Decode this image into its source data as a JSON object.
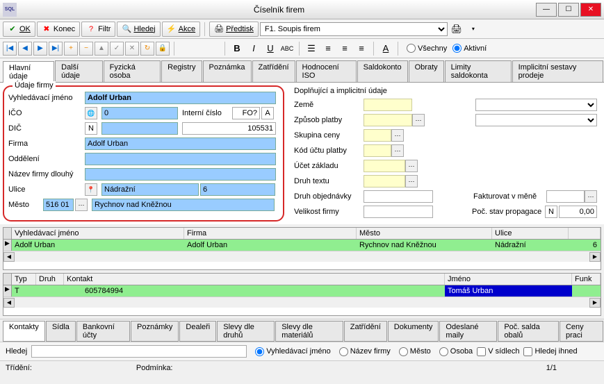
{
  "window": {
    "title": "Číselník firem",
    "icon_text": "SQL"
  },
  "toolbar1": {
    "ok": "OK",
    "konec": "Konec",
    "filtr": "Filtr",
    "hledej": "Hledej",
    "akce": "Akce",
    "predtisk": "Předtisk",
    "select_value": "F1. Soupis firem"
  },
  "toolbar2": {
    "radio_all": "Všechny",
    "radio_active": "Aktivní"
  },
  "tabs_main": [
    "Hlavní údaje",
    "Další údaje",
    "Fyzická osoba",
    "Registry",
    "Poznámka",
    "Zatřídění",
    "Hodnocení ISO",
    "Saldokonto",
    "Obraty",
    "Limity saldokonta",
    "Implicitní sestavy prodeje"
  ],
  "left_form": {
    "title": "Údaje firmy",
    "vyhledavaci_jmeno_label": "Vyhledávací jméno",
    "vyhledavaci_jmeno": "Adolf Urban",
    "ico_label": "IČO",
    "ico": "0",
    "interni_cislo_label": "Interní číslo",
    "interni_cislo": "FO?",
    "interni_suffix": "A",
    "dic_label": "DIČ",
    "dic_n": "N",
    "dic": "",
    "dic_num": "105531",
    "firma_label": "Firma",
    "firma": "Adolf Urban",
    "oddeleni_label": "Oddělení",
    "oddeleni": "",
    "nazev_dlouhy_label": "Název firmy dlouhý",
    "nazev_dlouhy": "",
    "ulice_label": "Ulice",
    "ulice": "Nádražní",
    "ulice_cislo": "6",
    "mesto_label": "Město",
    "psc": "516 01",
    "mesto": "Rychnov nad Kněžnou"
  },
  "right_form": {
    "title": "Doplňující a implicitní údaje",
    "zeme_label": "Země",
    "zpusob_platby_label": "Způsob platby",
    "skupina_ceny_label": "Skupina ceny",
    "kod_uctu_label": "Kód účtu platby",
    "ucet_zakladu_label": "Účet základu",
    "druh_textu_label": "Druh textu",
    "druh_obj_label": "Druh objednávky",
    "velikost_label": "Velikost firmy",
    "fakturovat_label": "Fakturovat v měně",
    "poc_stav_label": "Poč. stav propagace",
    "poc_stav_n": "N",
    "poc_stav_val": "0,00"
  },
  "grid1": {
    "headers": [
      "Vyhledávací jméno",
      "Firma",
      "Město",
      "Ulice",
      ""
    ],
    "row": [
      "Adolf Urban",
      "Adolf Urban",
      "Rychnov nad Kněžnou",
      "Nádražní",
      "6"
    ]
  },
  "grid2": {
    "headers": [
      "Typ",
      "Druh",
      "Kontakt",
      "Jméno",
      "Funk"
    ],
    "row": {
      "typ": "T",
      "druh": "",
      "kontakt": "605784994",
      "jmeno": "Tomáš Urban",
      "funk": ""
    }
  },
  "bottom_tabs": [
    "Kontakty",
    "Sídla",
    "Bankovní účty",
    "Poznámky",
    "Dealeři",
    "Slevy dle druhů",
    "Slevy dle materiálů",
    "Zatřídění",
    "Dokumenty",
    "Odeslané maily",
    "Poč. salda obalů",
    "Ceny praci"
  ],
  "search": {
    "label": "Hledej",
    "r_vyhl": "Vyhledávací jméno",
    "r_nazev": "Název firmy",
    "r_mesto": "Město",
    "r_osoba": "Osoba",
    "chk_sidlech": "V sídlech",
    "chk_ihned": "Hledej ihned"
  },
  "status": {
    "trideni": "Třídění:",
    "podminka": "Podmínka:",
    "counter": "1/1"
  }
}
